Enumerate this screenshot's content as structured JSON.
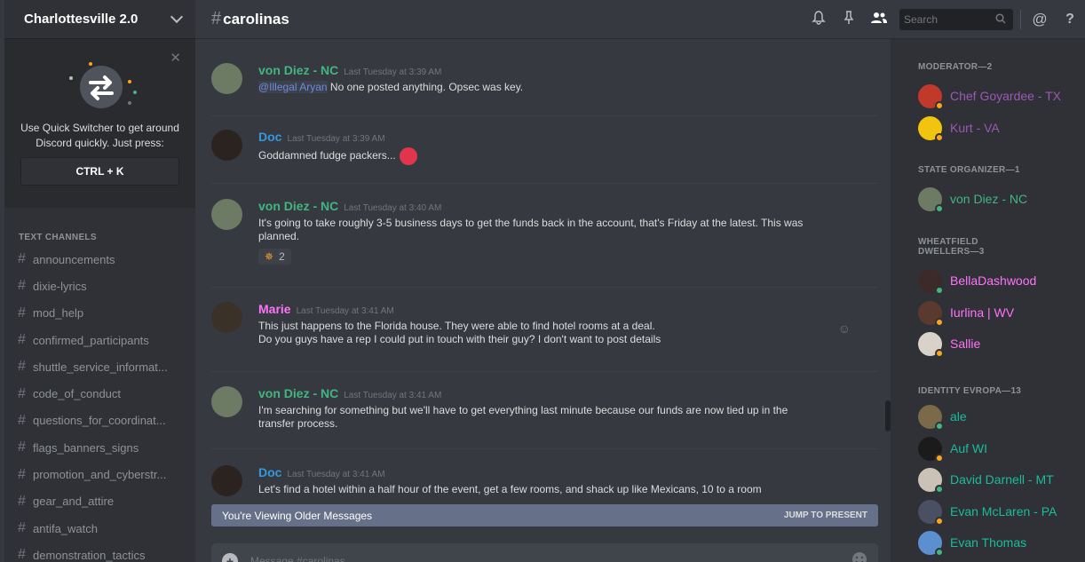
{
  "server": {
    "name": "Charlottesville 2.0"
  },
  "quick_switcher": {
    "text_line1": "Use Quick Switcher to get around",
    "text_line2": "Discord quickly. Just press:",
    "shortcut": "CTRL + K"
  },
  "sidebar": {
    "category": "TEXT CHANNELS",
    "channels": [
      "announcements",
      "dixie-lyrics",
      "mod_help",
      "confirmed_participants",
      "shuttle_service_informat...",
      "code_of_conduct",
      "questions_for_coordinat...",
      "flags_banners_signs",
      "promotion_and_cyberstr...",
      "gear_and_attire",
      "antifa_watch",
      "demonstration_tactics"
    ]
  },
  "topbar": {
    "channel": "carolinas",
    "search_placeholder": "Search"
  },
  "messages": [
    {
      "author": "von Diez - NC",
      "author_color": "#43b581",
      "timestamp": "Last Tuesday at 3:39 AM",
      "mention": "@Illegal Aryan",
      "lines": [
        "No one posted anything. Opsec was key."
      ]
    },
    {
      "author": "Doc",
      "author_color": "#3498db",
      "timestamp": "Last Tuesday at 3:39 AM",
      "lines": [
        "Goddamned fudge packers..."
      ]
    },
    {
      "author": "von Diez - NC",
      "author_color": "#43b581",
      "timestamp": "Last Tuesday at 3:40 AM",
      "lines": [
        "It's going to take roughly 3-5 business days to get the funds back in the account, that's Friday at the latest. This was",
        "planned."
      ],
      "reaction_count": "2"
    },
    {
      "author": "Marie",
      "author_color": "#ff73fa",
      "timestamp": "Last Tuesday at 3:41 AM",
      "lines": [
        "This just happens to the Florida house. They were able to find hotel rooms at a deal.",
        "Do you guys have a rep I could put in touch with their guy? I don't want to post details"
      ]
    },
    {
      "author": "von Diez - NC",
      "author_color": "#43b581",
      "timestamp": "Last Tuesday at 3:41 AM",
      "lines": [
        "I'm searching for something but we'll have to get everything last minute because our funds are now tied up in the",
        "transfer process."
      ]
    },
    {
      "author": "Doc",
      "author_color": "#3498db",
      "timestamp": "Last Tuesday at 3:41 AM",
      "lines": [
        "Let's find a hotel within a half hour of the event, get a few rooms, and shack up like Mexicans, 10 to a room"
      ]
    }
  ],
  "older_bar": {
    "label": "You're Viewing Older Messages",
    "jump": "JUMP TO PRESENT"
  },
  "composer": {
    "placeholder": "Message #carolinas"
  },
  "members": {
    "roles": [
      {
        "name": "MODERATOR—2",
        "members": [
          {
            "name": "Chef Goyardee - TX",
            "color": "#9b59b6",
            "status": "#faa61a",
            "avatar": "#c0392b"
          },
          {
            "name": "Kurt - VA",
            "color": "#9b59b6",
            "status": "#faa61a",
            "avatar": "#f1c40f"
          }
        ]
      },
      {
        "name": "STATE ORGANIZER—1",
        "members": [
          {
            "name": "von Diez - NC",
            "color": "#43b581",
            "status": "#43b581",
            "avatar": "#6d7a64"
          }
        ]
      },
      {
        "name": "WHEATFIELD",
        "name2": "DWELLERS—3",
        "members": [
          {
            "name": "BellaDashwood",
            "color": "#ff73fa",
            "status": "#43b581",
            "avatar": "#3b2a27"
          },
          {
            "name": "Iurlina | WV",
            "color": "#ff73fa",
            "status": "#faa61a",
            "avatar": "#5a3a2e"
          },
          {
            "name": "Sallie",
            "color": "#ff73fa",
            "status": "#faa61a",
            "avatar": "#d8d2c8"
          }
        ]
      },
      {
        "name": "IDENTITY EVROPA—13",
        "members": [
          {
            "name": "ale",
            "color": "#1abc9c",
            "status": "#43b581",
            "avatar": "#7a6a4a"
          },
          {
            "name": "Auf WI",
            "color": "#1abc9c",
            "status": "#faa61a",
            "avatar": "#1b1b1b"
          },
          {
            "name": "David Darnell - MT",
            "color": "#1abc9c",
            "status": "#43b581",
            "avatar": "#c9c2b5"
          },
          {
            "name": "Evan McLaren - PA",
            "color": "#1abc9c",
            "status": "#faa61a",
            "avatar": "#4a4f63"
          },
          {
            "name": "Evan Thomas",
            "color": "#1abc9c",
            "status": "#43b581",
            "avatar": "#5c8fd0"
          }
        ]
      }
    ]
  }
}
